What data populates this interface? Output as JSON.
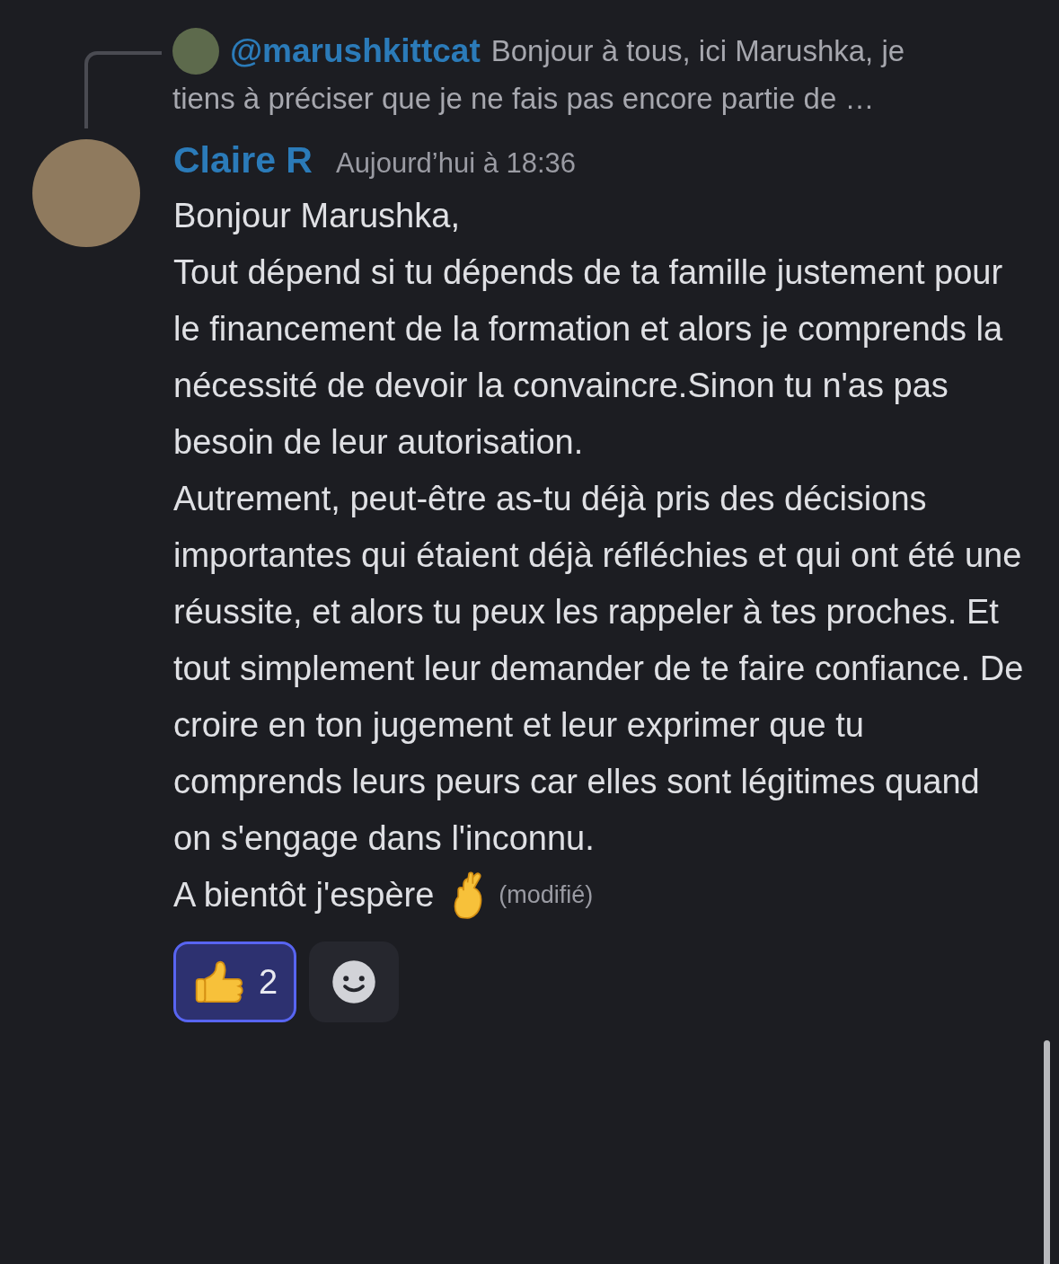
{
  "reply": {
    "username": "@marushkittcat",
    "preview_lines": [
      "Bonjour à tous, ici Marushka, je",
      "tiens à préciser que je ne fais pas encore partie de …"
    ]
  },
  "message": {
    "author": "Claire R",
    "timestamp": "Aujourd’hui à 18:36",
    "paragraphs": [
      "Bonjour Marushka,",
      "Tout dépend si tu dépends de ta famille justement pour le financement de la formation et alors je comprends la nécessité de devoir la convaincre.Sinon tu n'as pas besoin de leur autorisation.",
      "Autrement, peut-être as-tu déjà pris des décisions importantes qui étaient déjà réfléchies et qui ont été une réussite, et alors tu peux les rappeler à tes proches. Et tout simplement leur demander de te faire confiance. De croire en ton jugement et leur exprimer que tu comprends leurs peurs car elles sont légitimes quand on s'engage dans l'inconnu.",
      "A bientôt j'espère"
    ],
    "edited_label": "(modifié)",
    "reactions": [
      {
        "kind": "thumbs-up",
        "count": "2",
        "selected": true
      }
    ]
  }
}
